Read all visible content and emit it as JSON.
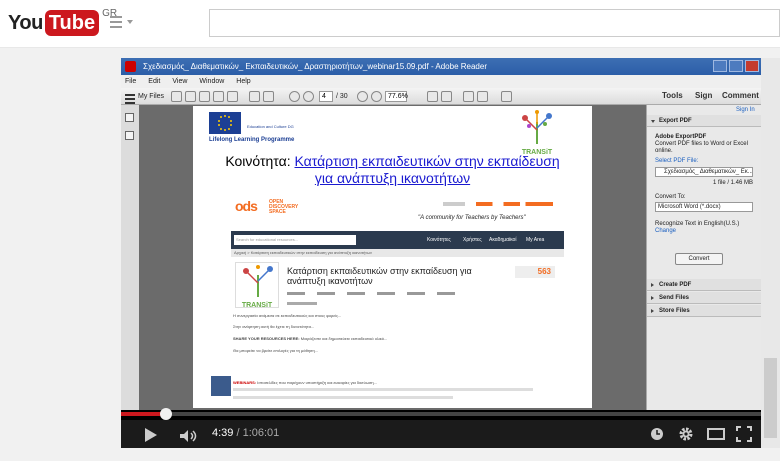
{
  "masthead": {
    "logo_you": "You",
    "logo_tube": "Tube",
    "country_code": "GR",
    "guide_icon": "menu-icon",
    "search_placeholder": ""
  },
  "reader": {
    "window_title": "Σχεδιασμός_ Διαθεματικών_ Εκπαιδευτικών_ Δραστηριοτήτων_webinar15.09.pdf - Adobe Reader",
    "menu": [
      "File",
      "Edit",
      "View",
      "Window",
      "Help"
    ],
    "toolbar": {
      "files_label": "My Files",
      "page_current": "4",
      "page_total": "/ 30",
      "zoom": "77.6%",
      "tools": "Tools",
      "sign": "Sign",
      "comment": "Comment"
    },
    "right_panel": {
      "sign_in": "Sign In",
      "export_header": "Export PDF",
      "export_service": "Adobe ExportPDF",
      "export_desc": "Convert PDF files to Word or Excel online.",
      "select_label": "Select PDF File:",
      "file_name": "Σχεδιασμός_ Διαθεματικών_ Εκ...",
      "file_info": "1 file / 1.46 MB",
      "convert_to_label": "Convert To:",
      "convert_to_value": "Microsoft Word (*.docx)",
      "recognize": "Recognize Text in English(U.S.)",
      "change": "Change",
      "convert_btn": "Convert",
      "create_pdf": "Create PDF",
      "send_files": "Send Files",
      "store_files": "Store Files"
    },
    "document": {
      "eu_caption": "Education and Culture DG",
      "llp": "Lifelong Learning Programme",
      "transit_logo": "TRANSiT",
      "community_label": "Κοινότητα:",
      "community_title_line1": "Κατάρτιση εκπαιδευτικών στην εκπαίδευση",
      "community_title_line2": "για ανάπτυξη ικανοτήτων",
      "ods_logo": "ods",
      "ods_name_line1": "OPEN",
      "ods_name_line2": "DISCOVERY",
      "ods_name_line3": "SPACE",
      "slogan": "\"A community for Teachers by Teachers\"",
      "search_placeholder": "Search for educational resources...",
      "nav": [
        "Κοινότητες",
        "Χρήστες",
        "Ακαδημαϊκοί",
        "My Area"
      ],
      "breadcrumb": "Αρχική > Κατάρτιση εκπαιδευτικών στην εκπαίδευση για ανάπτυξη ικανοτήτων",
      "card_title_line1": "Κατάρτιση εκπαιδευτικών στην εκπαίδευση για",
      "card_title_line2": "ανάπτυξη ικανοτήτων",
      "count": "563",
      "para1": "Η συνεργασία ανάμεσα σε εκπαιδευτικούς και στους φορείς...",
      "para2": "Στην ανάρτηση αυτή θα έχετε τη δυνατότητα...",
      "share_label": "SHARE YOUR RESOURCES HERE:",
      "share_text": "Μοιράζεστε και δημοσιεύετε εκπαιδευτικό υλικό...",
      "para4": "Θα μπορείτε να βρείτε επιλογές για τη μάθηση...",
      "webinars_label": "WEBINARS:",
      "para5": "Ιστοσελίδες που παρέχουν υποστήριξη και ευκαιρίες για δικτύωση..."
    }
  },
  "player": {
    "current_time": "4:39",
    "duration": "/ 1:06:01",
    "progress_fraction": 0.0704
  }
}
